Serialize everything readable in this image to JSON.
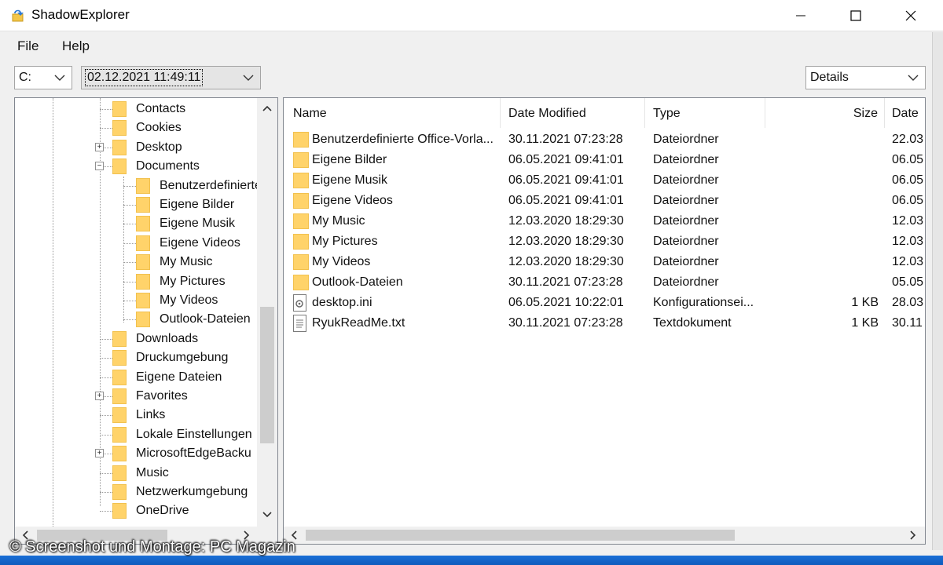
{
  "window": {
    "title": "ShadowExplorer"
  },
  "menu": {
    "file": "File",
    "help": "Help"
  },
  "drive_select": {
    "value": "C:"
  },
  "snapshot_select": {
    "value": "02.12.2021 11:49:11"
  },
  "view_select": {
    "value": "Details"
  },
  "tree": {
    "items": [
      {
        "label": "Contacts",
        "level": 1,
        "expander": ""
      },
      {
        "label": "Cookies",
        "level": 1,
        "expander": ""
      },
      {
        "label": "Desktop",
        "level": 1,
        "expander": "+"
      },
      {
        "label": "Documents",
        "level": 1,
        "expander": "−"
      },
      {
        "label": "Benutzerdefinierte",
        "level": 2,
        "expander": ""
      },
      {
        "label": "Eigene Bilder",
        "level": 2,
        "expander": ""
      },
      {
        "label": "Eigene Musik",
        "level": 2,
        "expander": ""
      },
      {
        "label": "Eigene Videos",
        "level": 2,
        "expander": ""
      },
      {
        "label": "My Music",
        "level": 2,
        "expander": ""
      },
      {
        "label": "My Pictures",
        "level": 2,
        "expander": ""
      },
      {
        "label": "My Videos",
        "level": 2,
        "expander": ""
      },
      {
        "label": "Outlook-Dateien",
        "level": 2,
        "expander": ""
      },
      {
        "label": "Downloads",
        "level": 1,
        "expander": ""
      },
      {
        "label": "Druckumgebung",
        "level": 1,
        "expander": ""
      },
      {
        "label": "Eigene Dateien",
        "level": 1,
        "expander": ""
      },
      {
        "label": "Favorites",
        "level": 1,
        "expander": "+"
      },
      {
        "label": "Links",
        "level": 1,
        "expander": ""
      },
      {
        "label": "Lokale Einstellungen",
        "level": 1,
        "expander": ""
      },
      {
        "label": "MicrosoftEdgeBacku",
        "level": 1,
        "expander": "+"
      },
      {
        "label": "Music",
        "level": 1,
        "expander": ""
      },
      {
        "label": "Netzwerkumgebung",
        "level": 1,
        "expander": ""
      },
      {
        "label": "OneDrive",
        "level": 1,
        "expander": ""
      }
    ]
  },
  "list": {
    "columns": {
      "name": "Name",
      "modified": "Date Modified",
      "type": "Type",
      "size": "Size",
      "date": "Date"
    },
    "rows": [
      {
        "icon": "folder-icon",
        "name": "Benutzerdefinierte Office-Vorla...",
        "modified": "30.11.2021 07:23:28",
        "type": "Dateiordner",
        "size": "",
        "date": "22.03"
      },
      {
        "icon": "folder-icon",
        "name": "Eigene Bilder",
        "modified": "06.05.2021 09:41:01",
        "type": "Dateiordner",
        "size": "",
        "date": "06.05"
      },
      {
        "icon": "folder-icon",
        "name": "Eigene Musik",
        "modified": "06.05.2021 09:41:01",
        "type": "Dateiordner",
        "size": "",
        "date": "06.05"
      },
      {
        "icon": "folder-icon",
        "name": "Eigene Videos",
        "modified": "06.05.2021 09:41:01",
        "type": "Dateiordner",
        "size": "",
        "date": "06.05"
      },
      {
        "icon": "folder-icon",
        "name": "My Music",
        "modified": "12.03.2020 18:29:30",
        "type": "Dateiordner",
        "size": "",
        "date": "12.03"
      },
      {
        "icon": "folder-icon",
        "name": "My Pictures",
        "modified": "12.03.2020 18:29:30",
        "type": "Dateiordner",
        "size": "",
        "date": "12.03"
      },
      {
        "icon": "folder-icon",
        "name": "My Videos",
        "modified": "12.03.2020 18:29:30",
        "type": "Dateiordner",
        "size": "",
        "date": "12.03"
      },
      {
        "icon": "folder-icon",
        "name": "Outlook-Dateien",
        "modified": "30.11.2021 07:23:28",
        "type": "Dateiordner",
        "size": "",
        "date": "05.05"
      },
      {
        "icon": "settings-file-icon",
        "name": "desktop.ini",
        "modified": "06.05.2021 10:22:01",
        "type": "Konfigurationsei...",
        "size": "1 KB",
        "date": "28.03"
      },
      {
        "icon": "text-file-icon",
        "name": "RyukReadMe.txt",
        "modified": "30.11.2021 07:23:28",
        "type": "Textdokument",
        "size": "1 KB",
        "date": "30.11"
      }
    ]
  },
  "watermark": {
    "text": "© Screenshot und Montage: PC Magazin"
  },
  "colors": {
    "folder": "#ffd36a",
    "border": "#828790",
    "background": "#f0f0f0"
  }
}
